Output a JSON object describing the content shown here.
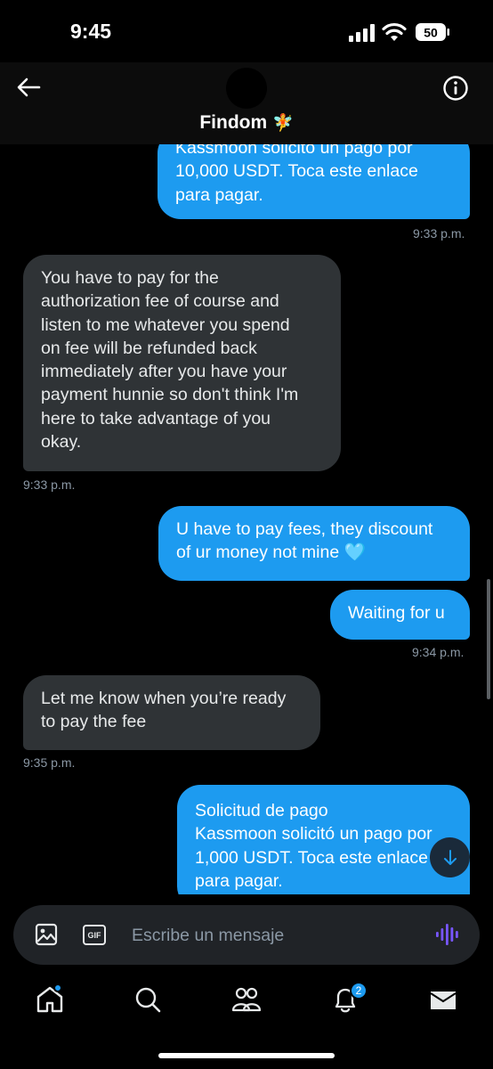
{
  "status_bar": {
    "time": "9:45",
    "battery": "50"
  },
  "header": {
    "title": "Findom",
    "title_emoji": "🧚",
    "back_icon": "arrow-left-icon",
    "info_icon": "info-circle-icon"
  },
  "messages": [
    {
      "side": "out",
      "lines": [
        "Kassmoon solicitó un pago por",
        "10,000 USDT. Toca este enlace",
        "para pagar."
      ],
      "timestamp": "9:33 p.m."
    },
    {
      "side": "in",
      "lines": [
        "You have to pay for the",
        "authorization fee of course and",
        "listen to me whatever you spend",
        "on fee will be refunded back",
        "immediately after you have your",
        "payment hunnie so don't think I'm",
        "here to take advantage of you",
        "okay."
      ],
      "timestamp": "9:33 p.m."
    },
    {
      "side": "out",
      "lines": [
        "U have to pay fees, they discount",
        "of ur money not mine 🩵"
      ]
    },
    {
      "side": "out",
      "lines": [
        "Waiting for u"
      ],
      "timestamp": "9:34 p.m."
    },
    {
      "side": "in",
      "lines": [
        "Let me know when you’re ready",
        "to pay the fee"
      ],
      "timestamp": "9:35 p.m."
    },
    {
      "side": "out",
      "lines": [
        "Solicitud de pago",
        "Kassmoon solicitó un pago por",
        "1,000 USDT. Toca este enlace",
        "para pagar."
      ]
    }
  ],
  "composer": {
    "placeholder": "Escribe un mensaje",
    "gif_label": "GIF",
    "image_icon": "image-icon",
    "voice_icon": "voice-waveform-icon"
  },
  "scroll_button_icon": "arrow-down-icon",
  "tabbar": {
    "items": [
      {
        "name": "home",
        "icon": "home-icon"
      },
      {
        "name": "search",
        "icon": "search-icon"
      },
      {
        "name": "communities",
        "icon": "people-icon"
      },
      {
        "name": "notifications",
        "icon": "bell-icon"
      },
      {
        "name": "messages",
        "icon": "envelope-icon"
      }
    ],
    "notifications_badge": "2"
  },
  "colors": {
    "outgoing_bubble": "#1d9bf0",
    "incoming_bubble": "#2f3336",
    "background": "#000000",
    "accent": "#1d9bf0",
    "voice_icon": "#7856ff"
  }
}
